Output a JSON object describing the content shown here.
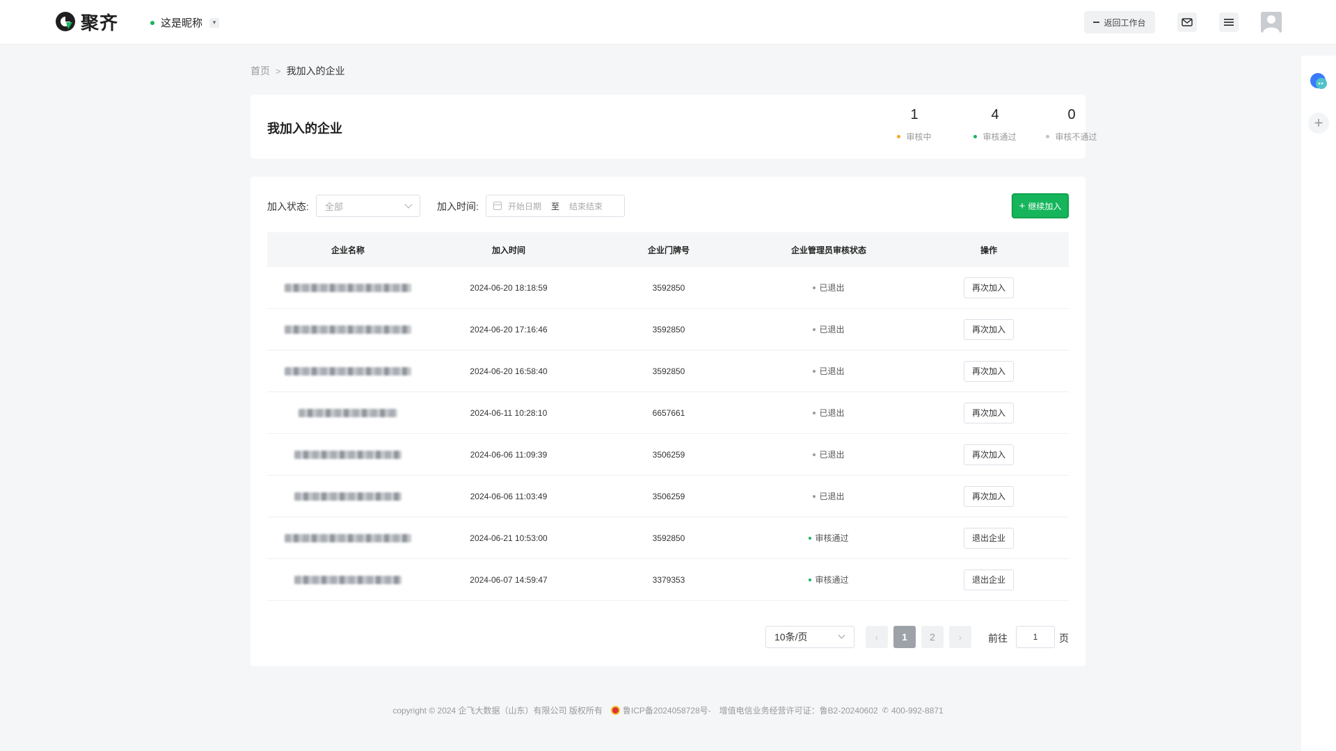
{
  "header": {
    "brand": "聚齐",
    "nickname": "这是昵称",
    "nickname_caret": "▾",
    "return_label": "返回工作台",
    "icons": [
      "mail-icon",
      "menu-icon",
      "avatar"
    ]
  },
  "breadcrumb": {
    "home": "首页",
    "separator": ">",
    "current": "我加入的企业"
  },
  "summary": {
    "title": "我加入的企业",
    "stats": [
      {
        "value": "1",
        "label": "审核中",
        "color": "#f5a623"
      },
      {
        "value": "4",
        "label": "审核通过",
        "color": "#16b55c"
      },
      {
        "value": "0",
        "label": "审核不通过",
        "color": "#c0c4cc"
      }
    ]
  },
  "filters": {
    "status_label": "加入状态:",
    "status_value": "全部",
    "time_label": "加入时间:",
    "start_placeholder": "开始日期",
    "to": "至",
    "end_placeholder": "结束结束",
    "join_button": "继续加入"
  },
  "table": {
    "columns": [
      "企业名称",
      "加入时间",
      "企业门牌号",
      "企业管理员审核状态",
      "操作"
    ],
    "rows": [
      {
        "time": "2024-06-20 18:18:59",
        "door": "3592850",
        "status": "已退出",
        "action": "再次加入"
      },
      {
        "time": "2024-06-20 17:16:46",
        "door": "3592850",
        "status": "已退出",
        "action": "再次加入"
      },
      {
        "time": "2024-06-20 16:58:40",
        "door": "3592850",
        "status": "已退出",
        "action": "再次加入"
      },
      {
        "time": "2024-06-11 10:28:10",
        "door": "6657661",
        "status": "已退出",
        "action": "再次加入"
      },
      {
        "time": "2024-06-06 11:09:39",
        "door": "3506259",
        "status": "已退出",
        "action": "再次加入"
      },
      {
        "time": "2024-06-06 11:03:49",
        "door": "3506259",
        "status": "已退出",
        "action": "再次加入"
      },
      {
        "time": "2024-06-21 10:53:00",
        "door": "3592850",
        "status": "审核通过",
        "action": "退出企业"
      },
      {
        "time": "2024-06-07 14:59:47",
        "door": "3379353",
        "status": "审核通过",
        "action": "退出企业"
      }
    ],
    "status_colors": {
      "已退出": "#999999",
      "审核通过": "#16b55c"
    }
  },
  "pagination": {
    "page_size": "10条/页",
    "prev": "‹",
    "next": "›",
    "pages": [
      "1",
      "2"
    ],
    "current": "1",
    "goto_label": "前往",
    "goto_value": "1",
    "page_unit": "页"
  },
  "footer": {
    "copyright": "copyright © 2024 企飞大数据（山东）有限公司 版权所有",
    "icp": "鲁ICP备2024058728号-",
    "license": "增值电信业务经营许可证：鲁B2-20240602",
    "phone": "400-992-8871"
  }
}
